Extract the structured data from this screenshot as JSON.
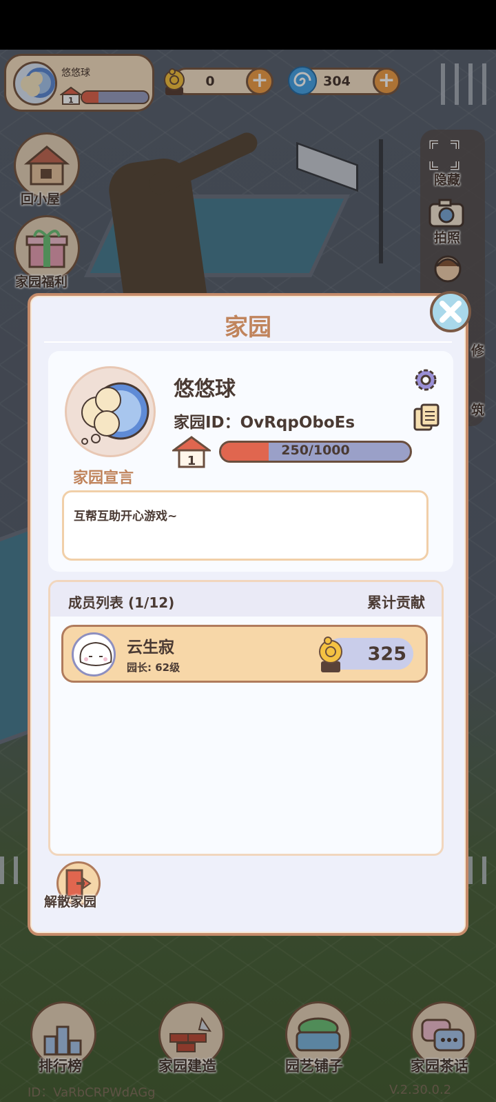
{
  "hud": {
    "home_name": "悠悠球",
    "home_level": "1",
    "level_progress": 0.25,
    "snail_coins": "0",
    "spiral_gems": "304"
  },
  "left_buttons": {
    "cabin": "回小屋",
    "welfare": "家园福利"
  },
  "right_buttons": {
    "hide": "隐藏",
    "photo": "拍照",
    "decorate_partial": "修",
    "build_partial": "筑"
  },
  "modal": {
    "title": "家园",
    "home_name": "悠悠球",
    "home_id_label": "家园ID：",
    "home_id": "OvRqpOboEs",
    "level": "1",
    "exp_text": "250/1000",
    "exp_progress": 0.25,
    "declaration_title": "家园宣言",
    "declaration_text": "互帮互助开心游戏~",
    "members_title": "成员列表 (1/12)",
    "contribution_header": "累计贡献",
    "members": [
      {
        "name": "云生寂",
        "role": "园长: 62级",
        "contribution": "325"
      }
    ],
    "disband_label": "解散家园"
  },
  "bottom_nav": {
    "ranking": "排行榜",
    "build": "家园建造",
    "garden_shop": "园艺铺子",
    "tea_talk": "家园茶话"
  },
  "footer": {
    "player_id": "ID：VaRbCRPWdAGg",
    "version": "V.2.30.0.2"
  },
  "colors": {
    "accent_orange": "#f0a04a",
    "title_brown": "#c0845c",
    "progress_red": "#e0664f",
    "modal_bg": "#eef0fa"
  }
}
